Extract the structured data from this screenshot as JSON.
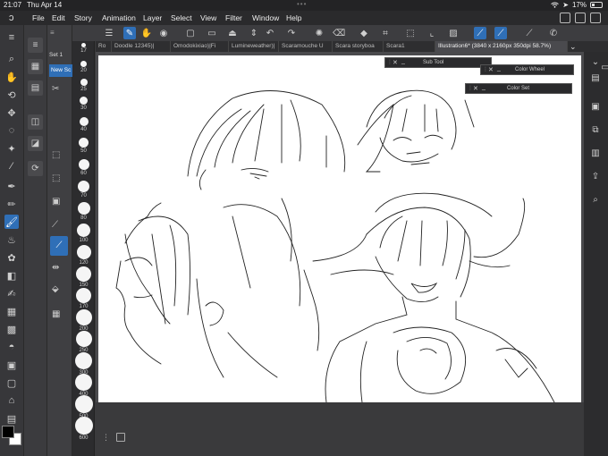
{
  "status": {
    "time": "21:07",
    "date": "Thu Apr 14",
    "battery": "17%",
    "wifi_icon": "wifi-icon"
  },
  "menu": [
    "File",
    "Edit",
    "Story",
    "Animation",
    "Layer",
    "Select",
    "View",
    "Filter",
    "Window",
    "Help"
  ],
  "tabs": [
    {
      "label": "Ro"
    },
    {
      "label": "Doodle 12345)|"
    },
    {
      "label": "Omodokixiao)|Fi"
    },
    {
      "label": "Lumineweather)|"
    },
    {
      "label": "Scaramouche U"
    },
    {
      "label": "Scara storyboa"
    },
    {
      "label": "Scara1"
    },
    {
      "label": "Illustration6* (3840 x 2160px 350dpi 58.7%)"
    }
  ],
  "subtool": {
    "group_label": "Set 1",
    "tool_label": "New Sc"
  },
  "brush_sizes": [
    "17",
    "20",
    "25",
    "30",
    "40",
    "50",
    "60",
    "70",
    "80",
    "100",
    "120",
    "150",
    "170",
    "200",
    "250",
    "300",
    "400",
    "500",
    "600"
  ],
  "palettes": {
    "sub_tool": "Sub Tool",
    "color_wheel": "Color Wheel",
    "color_set": "Color Set"
  },
  "colors": {
    "accent": "#2f6fb7",
    "main_color": "#000000",
    "sub_color": "#ffffff"
  }
}
